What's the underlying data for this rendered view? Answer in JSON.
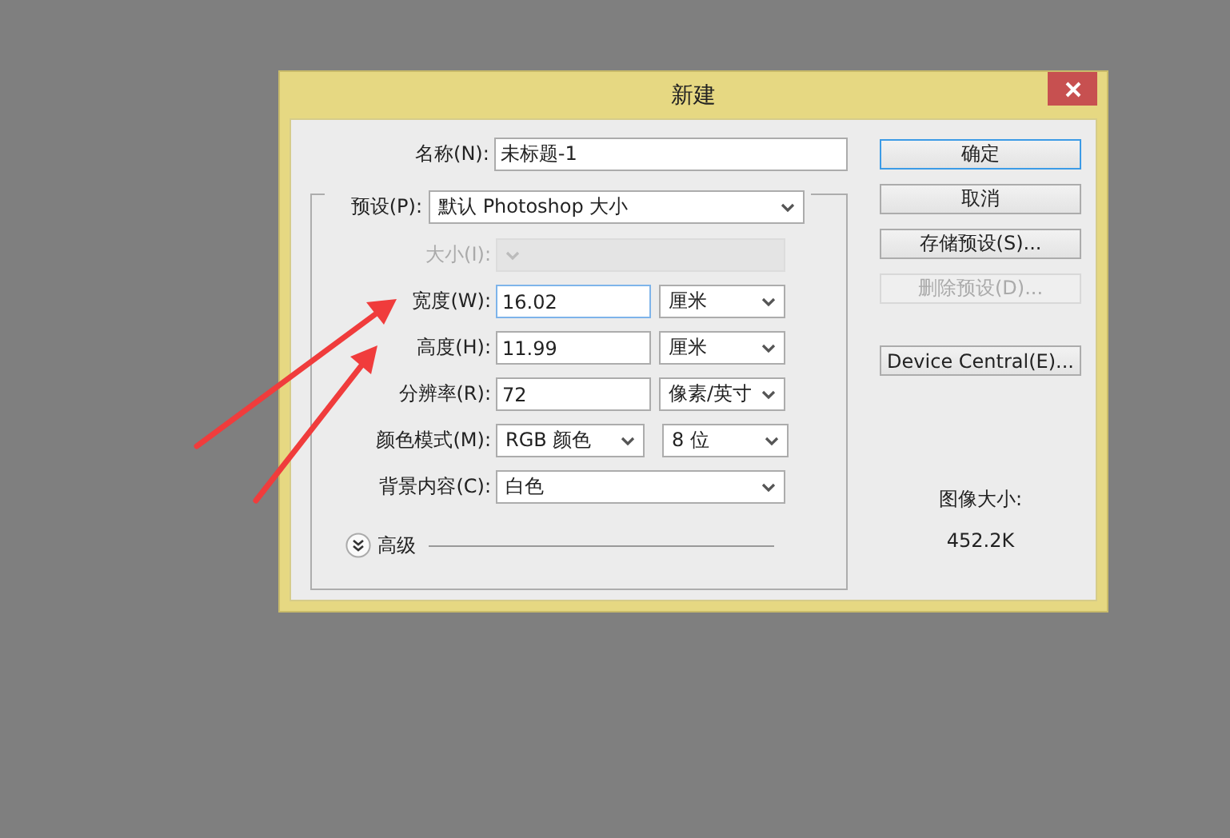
{
  "window": {
    "title": "新建"
  },
  "name_field": {
    "label": "名称(N):",
    "value": "未标题-1"
  },
  "preset": {
    "label": "预设(P):",
    "value": "默认 Photoshop 大小"
  },
  "rows": [
    {
      "label": "大小(I):",
      "disabled": true,
      "fields": [
        {
          "kind": "select",
          "wide": true
        }
      ]
    },
    {
      "label": "宽度(W):",
      "disabled": false,
      "fields": [
        {
          "kind": "input",
          "value": "16.02",
          "focused": true
        },
        {
          "kind": "select",
          "value": "厘米"
        }
      ]
    },
    {
      "label": "高度(H):",
      "disabled": false,
      "fields": [
        {
          "kind": "input",
          "value": "11.99",
          "focused": false
        },
        {
          "kind": "select",
          "value": "厘米"
        }
      ]
    },
    {
      "label": "分辨率(R):",
      "disabled": false,
      "fields": [
        {
          "kind": "input",
          "value": "72",
          "focused": false
        },
        {
          "kind": "select",
          "value": "像素/英寸"
        }
      ]
    },
    {
      "label": "颜色模式(M):",
      "disabled": false,
      "fields": [
        {
          "kind": "select",
          "value": "RGB 颜色"
        },
        {
          "kind": "select",
          "value": "8 位"
        }
      ]
    },
    {
      "label": "背景内容(C):",
      "disabled": false,
      "fields": [
        {
          "kind": "select",
          "value": "白色",
          "wide": true
        }
      ]
    }
  ],
  "advanced": {
    "label": "高级"
  },
  "buttons": [
    {
      "label": "确定",
      "disabled": false,
      "default": true
    },
    {
      "label": "取消",
      "disabled": false,
      "default": false
    },
    {
      "label": "存储预设(S)...",
      "disabled": false,
      "default": false
    },
    {
      "label": "删除预设(D)...",
      "disabled": true,
      "default": false
    },
    {
      "label": "Device Central(E)...",
      "disabled": false,
      "default": false
    }
  ],
  "image_size": {
    "label": "图像大小:",
    "value": "452.2K"
  }
}
